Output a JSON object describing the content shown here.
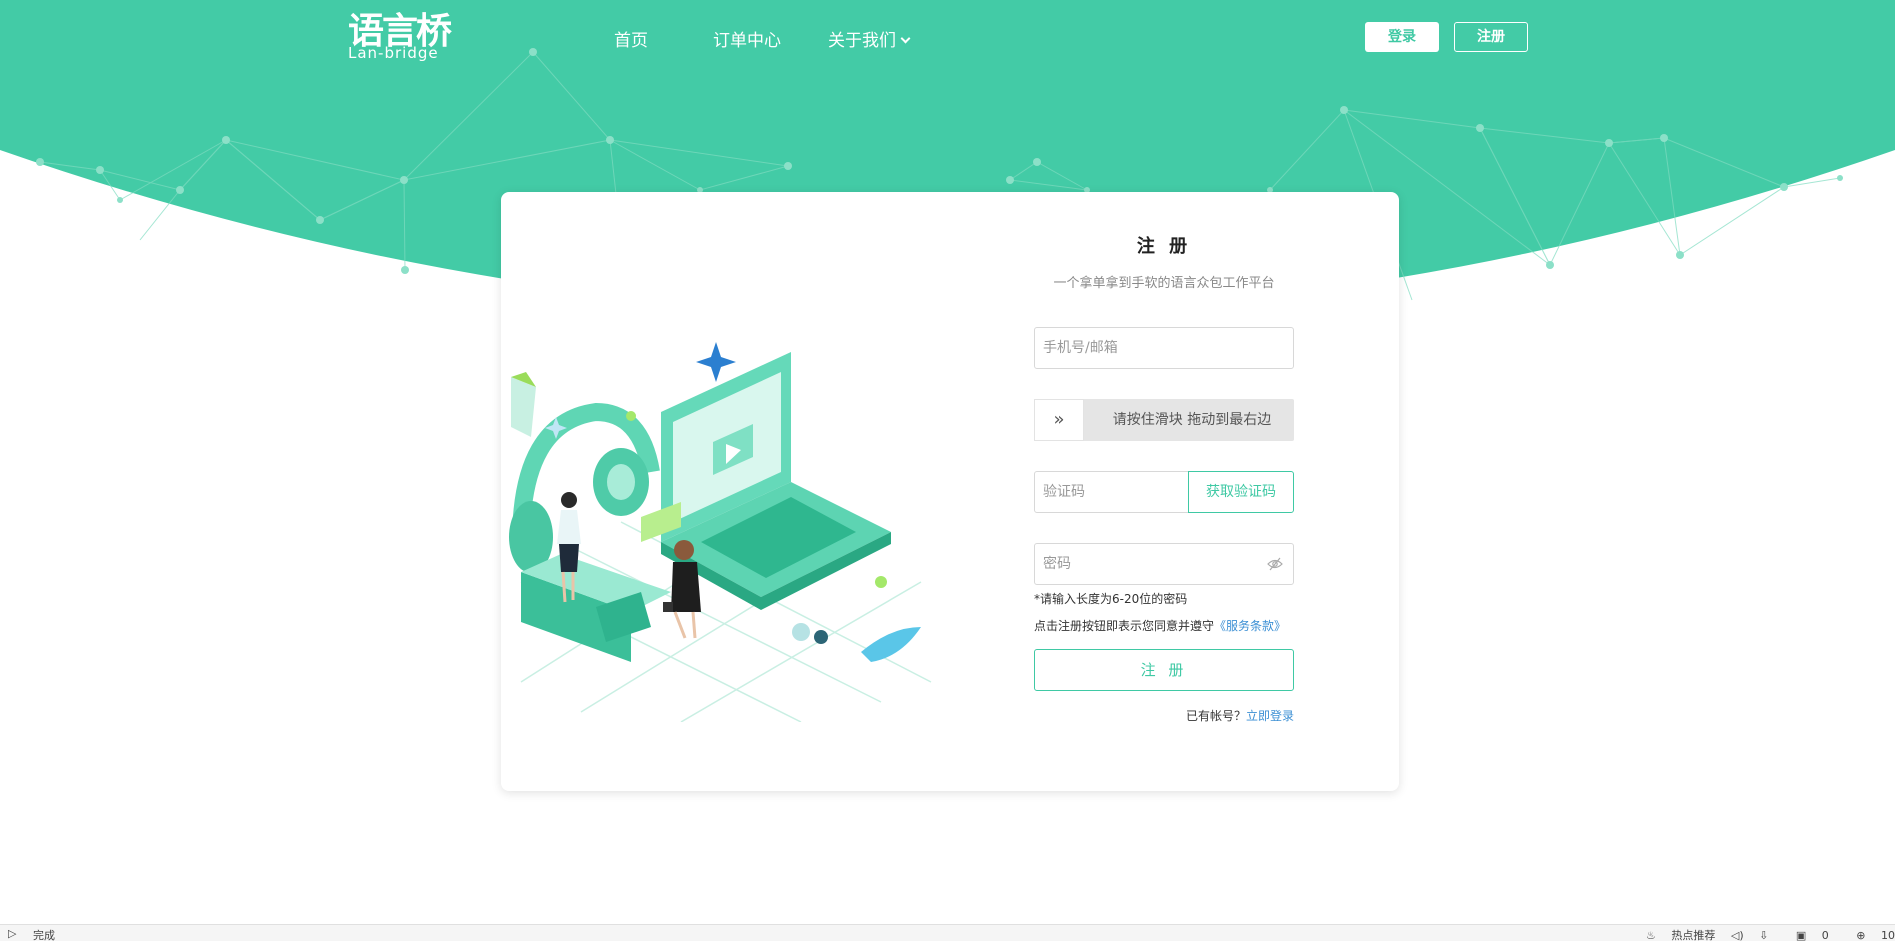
{
  "header": {
    "logo_cn": "语言桥",
    "logo_en": "Lan-bridge",
    "nav": {
      "home": "首页",
      "orders": "订单中心",
      "about": "关于我们"
    },
    "login_button": "登录",
    "register_button": "注册"
  },
  "form": {
    "title": "注 册",
    "subtitle": "一个拿单拿到手软的语言众包工作平台",
    "account_placeholder": "手机号/邮箱",
    "slider_text": "请按住滑块  拖动到最右边",
    "slider_handle": "»",
    "code_placeholder": "验证码",
    "get_code_button": "获取验证码",
    "password_placeholder": "密码",
    "password_hint": "*请输入长度为6-20位的密码",
    "terms_prefix": "点击注册按钮即表示您同意并遵守",
    "terms_link": "《服务条款》",
    "submit_button": "注 册",
    "have_account": "已有帐号？",
    "login_link": "立即登录"
  },
  "statusbar": {
    "status": "完成",
    "hot": "热点推荐",
    "count": "0",
    "zoom": "10"
  },
  "colors": {
    "brand_green": "#43cba6",
    "link_blue": "#3b8fd4"
  }
}
